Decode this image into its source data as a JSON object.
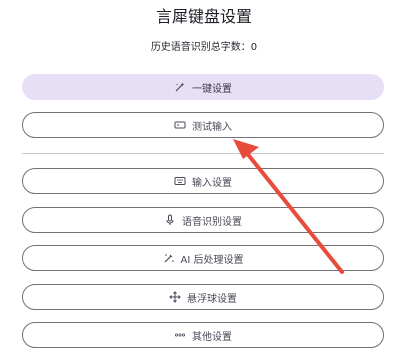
{
  "page": {
    "title": "言犀键盘设置",
    "history_label": "历史语音识别总字数：0"
  },
  "buttons": {
    "one_key": {
      "label": "一键设置",
      "icon": "magic-wand-icon"
    },
    "test_input": {
      "label": "测试输入",
      "icon": "keyboard-box-icon"
    },
    "input_settings": {
      "label": "输入设置",
      "icon": "keyboard-icon"
    },
    "voice_settings": {
      "label": "语音识别设置",
      "icon": "microphone-icon"
    },
    "ai_post": {
      "label": "AI 后处理设置",
      "icon": "sparkle-wand-icon"
    },
    "float_ball": {
      "label": "悬浮球设置",
      "icon": "move-arrows-icon"
    },
    "other": {
      "label": "其他设置",
      "icon": "more-dots-icon"
    }
  },
  "annotation": {
    "arrow_color": "#e84a3b"
  },
  "colors": {
    "primary_fill": "#e6dff6",
    "outline": "#73707c"
  }
}
